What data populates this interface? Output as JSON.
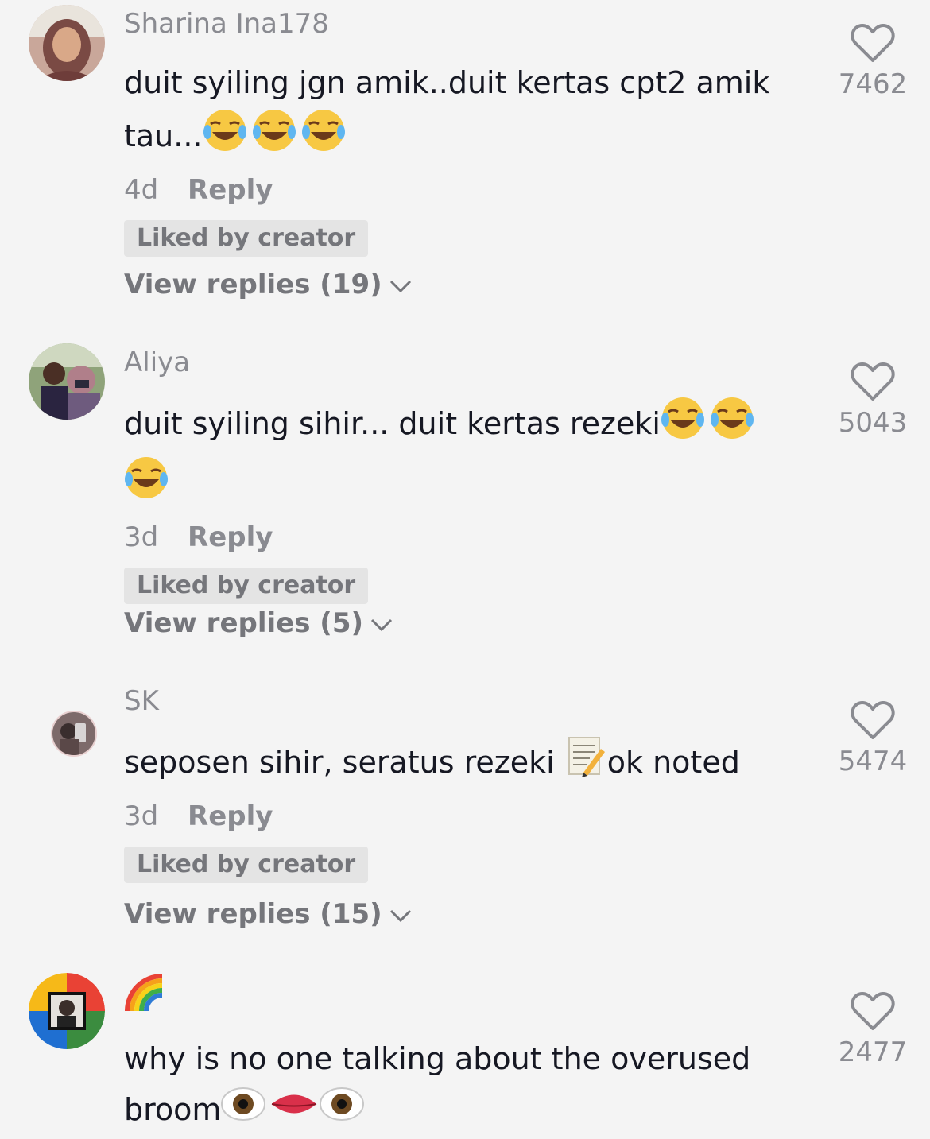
{
  "comments": [
    {
      "username": "Sharina Ina178",
      "text_line1": "duit syiling jgn amik..duit kertas cpt2 amik",
      "text_line2": "tau...",
      "time": "4d",
      "reply_label": "Reply",
      "liked_badge": "Liked by creator",
      "view_replies": "View replies (19)",
      "likes": "7462"
    },
    {
      "username": "Aliya",
      "text_line1": "duit syiling sihir... duit kertas rezeki",
      "time": "3d",
      "reply_label": "Reply",
      "liked_badge": "Liked by creator",
      "view_replies": "View replies (5)",
      "likes": "5043"
    },
    {
      "username": "SK",
      "text_part1": "seposen sihir, seratus rezeki",
      "text_part2": "ok noted",
      "time": "3d",
      "reply_label": "Reply",
      "liked_badge": "Liked by creator",
      "view_replies": "View replies (15)",
      "likes": "5474"
    },
    {
      "username_icon": "rainbow-emoji",
      "text_line1": "why is no one talking about the overused",
      "text_line2": "broom",
      "likes": "2477"
    }
  ],
  "icons": {
    "heart": "heart-outline-icon",
    "chevron": "chevron-down-icon"
  },
  "colors": {
    "background": "#f4f4f4",
    "username": "#8a8b91",
    "text": "#161823",
    "badge_bg": "#e4e4e4"
  }
}
